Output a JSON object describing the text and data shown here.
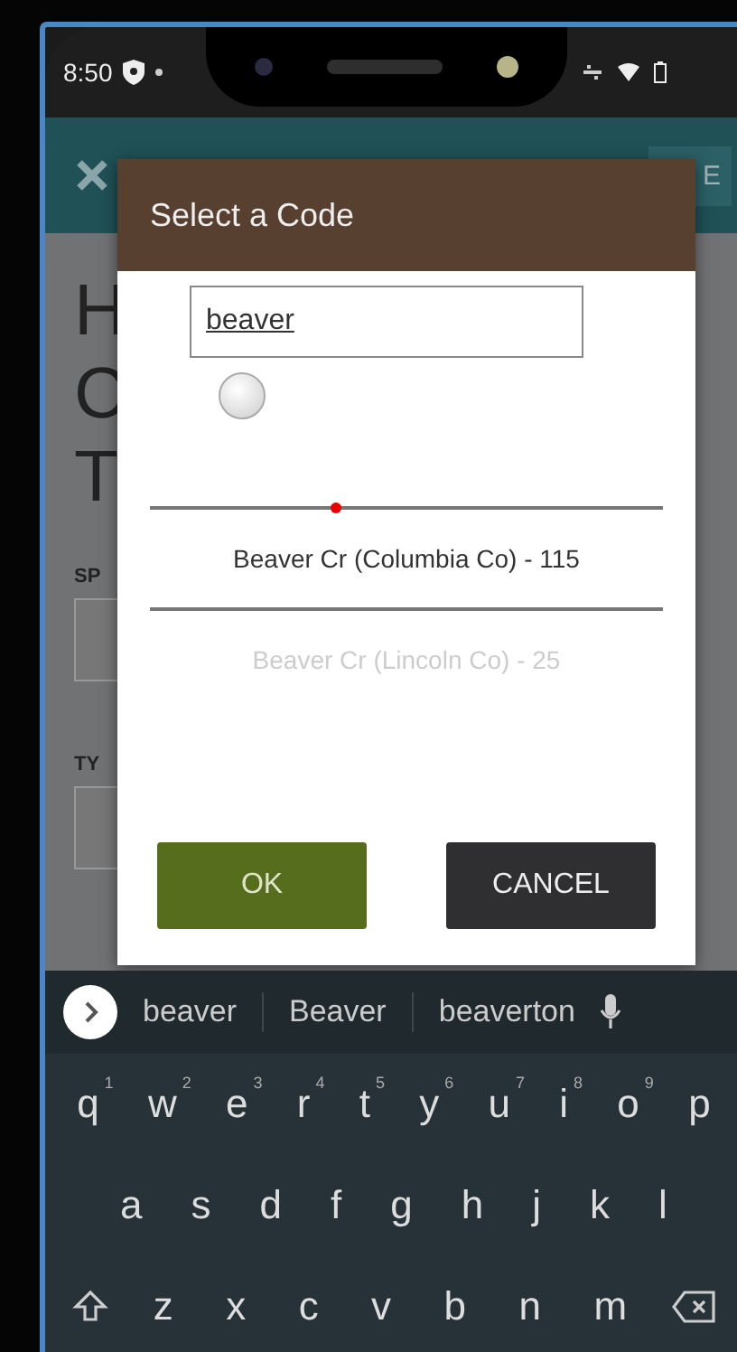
{
  "status_bar": {
    "time": "8:50"
  },
  "background": {
    "app_bar_button": "E",
    "heading_letters": [
      "H",
      "C",
      "T"
    ],
    "labels": [
      "SP",
      "TY"
    ]
  },
  "dialog": {
    "title": "Select a Code",
    "search": {
      "value": "beaver"
    },
    "radio": {
      "checked": false
    },
    "options": [
      {
        "label": "Beaver Cr (Columbia Co) - 115",
        "selected": true
      },
      {
        "label": "Beaver Cr (Lincoln Co) - 25",
        "selected": false
      }
    ],
    "buttons": [
      {
        "label": "OK",
        "kind": "primary"
      },
      {
        "label": "CANCEL",
        "kind": "secondary"
      }
    ]
  },
  "keyboard": {
    "suggestions": [
      "beaver",
      "Beaver",
      "beaverton"
    ],
    "rows": [
      [
        {
          "key": "q",
          "hint": "1"
        },
        {
          "key": "w",
          "hint": "2"
        },
        {
          "key": "e",
          "hint": "3"
        },
        {
          "key": "r",
          "hint": "4"
        },
        {
          "key": "t",
          "hint": "5"
        },
        {
          "key": "y",
          "hint": "6"
        },
        {
          "key": "u",
          "hint": "7"
        },
        {
          "key": "i",
          "hint": "8"
        },
        {
          "key": "o",
          "hint": "9"
        },
        {
          "key": "p"
        }
      ],
      [
        {
          "key": "a"
        },
        {
          "key": "s"
        },
        {
          "key": "d"
        },
        {
          "key": "f"
        },
        {
          "key": "g"
        },
        {
          "key": "h"
        },
        {
          "key": "j"
        },
        {
          "key": "k"
        },
        {
          "key": "l"
        }
      ],
      [
        {
          "key": "z"
        },
        {
          "key": "x"
        },
        {
          "key": "c"
        },
        {
          "key": "v"
        },
        {
          "key": "b"
        },
        {
          "key": "n"
        },
        {
          "key": "m"
        }
      ]
    ]
  }
}
